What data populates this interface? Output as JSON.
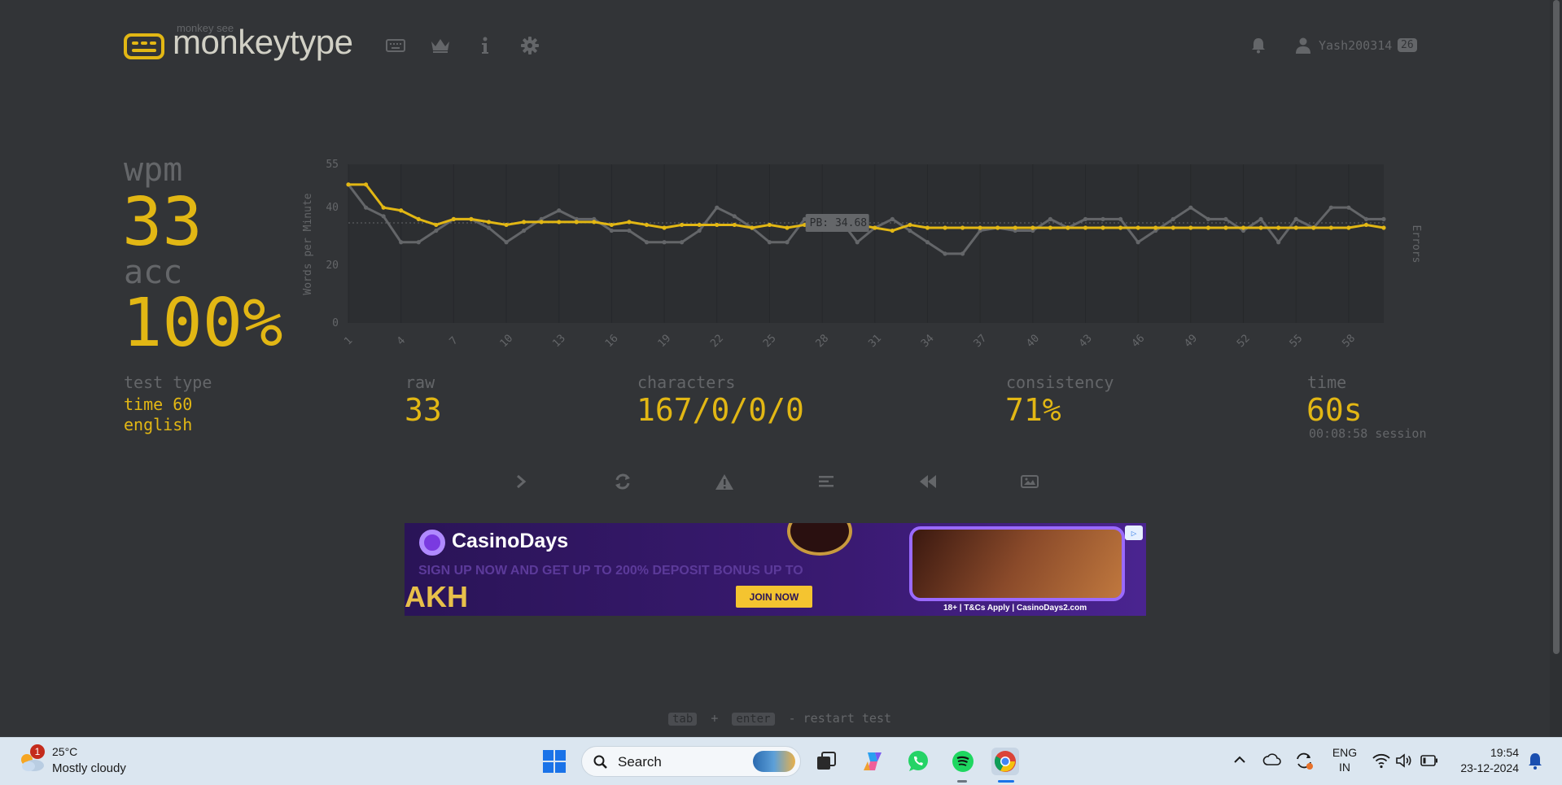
{
  "header": {
    "logo_tagline": "monkey see",
    "logo_text": "monkeytype",
    "nav_icons": [
      "keyboard-icon",
      "crown-icon",
      "info-icon",
      "gear-icon"
    ],
    "user_name": "Yash200314",
    "user_level": "26"
  },
  "stats": {
    "wpm_label": "wpm",
    "wpm_value": "33",
    "acc_label": "acc",
    "acc_value": "100%",
    "test_type_label": "test type",
    "test_type_line1": "time 60",
    "test_type_line2": "english",
    "raw_label": "raw",
    "raw_value": "33",
    "characters_label": "characters",
    "characters_value": "167/0/0/0",
    "consistency_label": "consistency",
    "consistency_value": "71%",
    "time_label": "time",
    "time_value": "60s",
    "session_value": "00:08:58 session"
  },
  "chart_data": {
    "type": "line",
    "ylabel": "Words per Minute",
    "y2label": "Errors",
    "ylim": [
      0,
      55
    ],
    "yticks": [
      "55",
      "40",
      "20",
      "0"
    ],
    "x": [
      1,
      2,
      3,
      4,
      5,
      6,
      7,
      8,
      9,
      10,
      11,
      12,
      13,
      14,
      15,
      16,
      17,
      18,
      19,
      20,
      21,
      22,
      23,
      24,
      25,
      26,
      27,
      28,
      29,
      30,
      31,
      32,
      33,
      34,
      35,
      36,
      37,
      38,
      39,
      40,
      41,
      42,
      43,
      44,
      45,
      46,
      47,
      48,
      49,
      50,
      51,
      52,
      53,
      54,
      55,
      56,
      57,
      58,
      59,
      60
    ],
    "xtick_labels": [
      "1",
      "4",
      "7",
      "10",
      "13",
      "16",
      "19",
      "22",
      "25",
      "28",
      "31",
      "34",
      "37",
      "40",
      "43",
      "46",
      "49",
      "52",
      "55",
      "58"
    ],
    "pb_label": "PB: 34.68",
    "pb_value": 34.68,
    "series": [
      {
        "name": "wpm",
        "color": "#e2b714",
        "values": [
          48,
          48,
          40,
          39,
          36,
          34,
          36,
          36,
          35,
          34,
          35,
          35,
          35,
          35,
          35,
          34,
          35,
          34,
          33,
          34,
          34,
          34,
          34,
          33,
          34,
          33,
          34,
          34,
          34,
          34,
          33,
          32,
          34,
          33,
          33,
          33,
          33,
          33,
          33,
          33,
          33,
          33,
          33,
          33,
          33,
          33,
          33,
          33,
          33,
          33,
          33,
          33,
          33,
          33,
          33,
          33,
          33,
          33,
          34,
          33
        ]
      },
      {
        "name": "raw",
        "color": "#646669",
        "values": [
          48,
          40,
          37,
          28,
          28,
          32,
          36,
          36,
          33,
          28,
          32,
          36,
          39,
          36,
          36,
          32,
          32,
          28,
          28,
          28,
          32,
          40,
          37,
          33,
          28,
          28,
          36,
          36,
          36,
          28,
          33,
          36,
          32,
          28,
          24,
          24,
          32,
          33,
          32,
          32,
          36,
          33,
          36,
          36,
          36,
          28,
          32,
          36,
          40,
          36,
          36,
          32,
          36,
          28,
          36,
          33,
          40,
          40,
          36,
          36
        ]
      }
    ]
  },
  "actions": {
    "icons": [
      "next-test-icon",
      "restart-icon",
      "report-icon",
      "words-history-icon",
      "replay-icon",
      "screenshot-icon"
    ]
  },
  "ad": {
    "brand": "CasinoDays",
    "subtitle": "SIGN UP NOW AND GET UP TO 200% DEPOSIT BONUS UP TO",
    "big_text": "AKH",
    "button": "JOIN NOW",
    "terms": "18+ | T&Cs Apply | CasinoDays2.com"
  },
  "footer": {
    "key1": "tab",
    "plus": "+",
    "key2": "enter",
    "hint": "- restart test"
  },
  "taskbar": {
    "weather_badge": "1",
    "temperature": "25°C",
    "weather_desc": "Mostly cloudy",
    "search_placeholder": "Search",
    "lang_line1": "ENG",
    "lang_line2": "IN",
    "time": "19:54",
    "date": "23-12-2024"
  },
  "colors": {
    "background": "#323437",
    "accent": "#e2b714",
    "sub": "#646669",
    "text": "#d1d0c5"
  }
}
